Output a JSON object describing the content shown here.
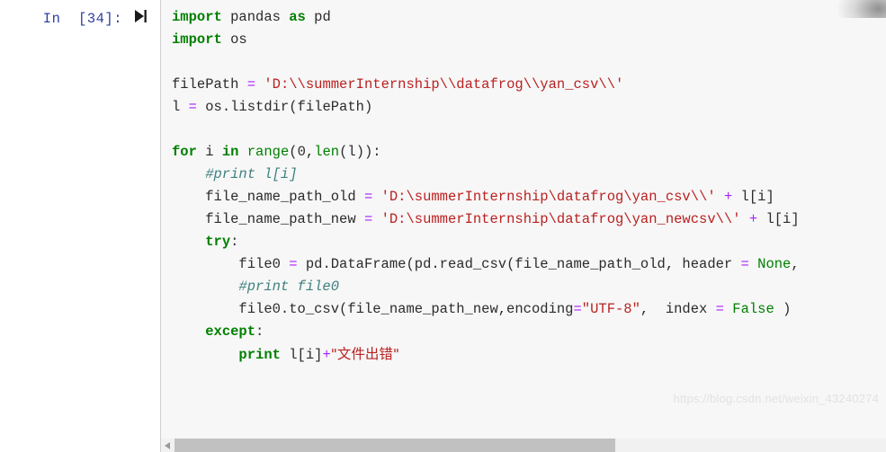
{
  "cell": {
    "prompt": "In  [34]:",
    "run_icon": "run-to-end-icon",
    "execution_count": "34"
  },
  "code": {
    "lines": [
      [
        {
          "t": "import",
          "c": "kw"
        },
        {
          "t": " pandas ",
          "c": "plain"
        },
        {
          "t": "as",
          "c": "kw"
        },
        {
          "t": " pd",
          "c": "plain"
        }
      ],
      [
        {
          "t": "import",
          "c": "kw"
        },
        {
          "t": " os",
          "c": "plain"
        }
      ],
      [],
      [
        {
          "t": "filePath ",
          "c": "plain"
        },
        {
          "t": "=",
          "c": "op"
        },
        {
          "t": " ",
          "c": "plain"
        },
        {
          "t": "'D:\\\\summerInternship\\\\datafrog\\\\yan_csv\\\\'",
          "c": "str"
        }
      ],
      [
        {
          "t": "l ",
          "c": "plain"
        },
        {
          "t": "=",
          "c": "op"
        },
        {
          "t": " os.listdir(filePath)",
          "c": "plain"
        }
      ],
      [],
      [
        {
          "t": "for",
          "c": "kw"
        },
        {
          "t": " i ",
          "c": "plain"
        },
        {
          "t": "in",
          "c": "kw"
        },
        {
          "t": " ",
          "c": "plain"
        },
        {
          "t": "range",
          "c": "bi"
        },
        {
          "t": "(",
          "c": "plain"
        },
        {
          "t": "0",
          "c": "plain"
        },
        {
          "t": ",",
          "c": "plain"
        },
        {
          "t": "len",
          "c": "bi"
        },
        {
          "t": "(l)):",
          "c": "plain"
        }
      ],
      [
        {
          "t": "    #print l[i]",
          "c": "cmt"
        }
      ],
      [
        {
          "t": "    file_name_path_old ",
          "c": "plain"
        },
        {
          "t": "=",
          "c": "op"
        },
        {
          "t": " ",
          "c": "plain"
        },
        {
          "t": "'D:\\summerInternship\\datafrog\\yan_csv\\\\'",
          "c": "str"
        },
        {
          "t": " ",
          "c": "plain"
        },
        {
          "t": "+",
          "c": "op"
        },
        {
          "t": " l[i]",
          "c": "plain"
        }
      ],
      [
        {
          "t": "    file_name_path_new ",
          "c": "plain"
        },
        {
          "t": "=",
          "c": "op"
        },
        {
          "t": " ",
          "c": "plain"
        },
        {
          "t": "'D:\\summerInternship\\datafrog\\yan_newcsv\\\\'",
          "c": "str"
        },
        {
          "t": " ",
          "c": "plain"
        },
        {
          "t": "+",
          "c": "op"
        },
        {
          "t": " l[i]",
          "c": "plain"
        }
      ],
      [
        {
          "t": "    ",
          "c": "plain"
        },
        {
          "t": "try",
          "c": "kw"
        },
        {
          "t": ":",
          "c": "plain"
        }
      ],
      [
        {
          "t": "        file0 ",
          "c": "plain"
        },
        {
          "t": "=",
          "c": "op"
        },
        {
          "t": " pd.DataFrame(pd.read_csv(file_name_path_old, header ",
          "c": "plain"
        },
        {
          "t": "=",
          "c": "op"
        },
        {
          "t": " ",
          "c": "plain"
        },
        {
          "t": "None",
          "c": "bi"
        },
        {
          "t": ",",
          "c": "plain"
        }
      ],
      [
        {
          "t": "        #print file0",
          "c": "cmt"
        }
      ],
      [
        {
          "t": "        file0.to_csv(file_name_path_new,encoding",
          "c": "plain"
        },
        {
          "t": "=",
          "c": "op"
        },
        {
          "t": "\"UTF-8\"",
          "c": "str"
        },
        {
          "t": ",  index ",
          "c": "plain"
        },
        {
          "t": "=",
          "c": "op"
        },
        {
          "t": " ",
          "c": "plain"
        },
        {
          "t": "False",
          "c": "bi"
        },
        {
          "t": " )",
          "c": "plain"
        }
      ],
      [
        {
          "t": "    ",
          "c": "plain"
        },
        {
          "t": "except",
          "c": "kw"
        },
        {
          "t": ":",
          "c": "plain"
        }
      ],
      [
        {
          "t": "        ",
          "c": "plain"
        },
        {
          "t": "print",
          "c": "kw"
        },
        {
          "t": " l[i]",
          "c": "plain"
        },
        {
          "t": "+",
          "c": "op"
        },
        {
          "t": "\"文件出错\"",
          "c": "cjk"
        }
      ]
    ]
  },
  "watermark": {
    "text": "https://blog.csdn.net/weixin_43240274"
  },
  "scrollbar": {
    "left_arrow": "scroll-left-arrow-icon",
    "thumb_percent": 62
  },
  "colors": {
    "keyword": "#008000",
    "string": "#ba2121",
    "comment": "#408080",
    "operator": "#aa22ff",
    "prompt": "#303f9f",
    "code_background": "#f7f7f7",
    "page_background": "#ffffff"
  }
}
